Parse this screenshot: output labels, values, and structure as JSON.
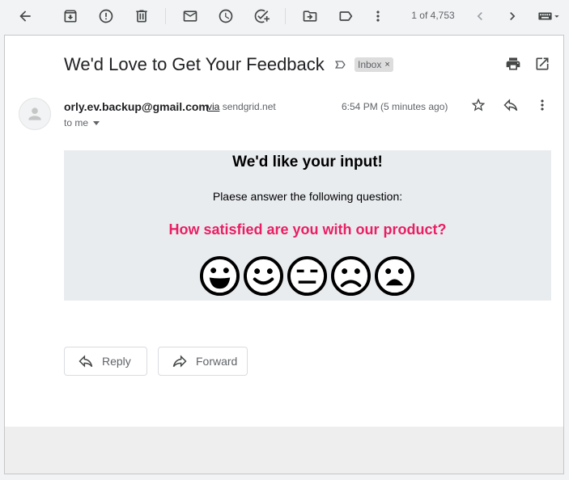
{
  "toolbar": {
    "back_icon": "arrow-left-icon",
    "pager_text": "1 of 4,753"
  },
  "message": {
    "subject": "We'd Love to Get Your Feedback",
    "label": "Inbox",
    "label_close": "×",
    "sender_email": "orly.ev.backup@gmail.com",
    "via_word": "via",
    "via_domain": "sendgrid.net",
    "recipient": "to me",
    "time": "6:54 PM (5 minutes ago)"
  },
  "body": {
    "title": "We'd like your input!",
    "subtitle": "Plaese answer the following question:",
    "question": "How satisfied are you with our product?",
    "rating_faces": [
      "very-happy",
      "happy",
      "neutral",
      "sad",
      "very-sad"
    ]
  },
  "actions": {
    "reply": "Reply",
    "forward": "Forward"
  },
  "colors": {
    "question": "#e91e63",
    "card_bg": "#e9ecef"
  }
}
